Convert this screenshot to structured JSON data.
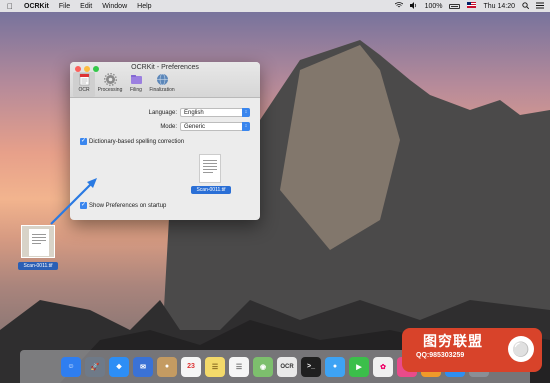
{
  "menubar": {
    "app_name": "OCRKit",
    "items": [
      "File",
      "Edit",
      "Window",
      "Help"
    ],
    "battery": "100%",
    "clock": "Thu 14:20"
  },
  "window": {
    "title": "OCRKit - Preferences",
    "toolbar": [
      {
        "label": "OCR",
        "icon": "ocr-icon"
      },
      {
        "label": "Processing",
        "icon": "gear-icon"
      },
      {
        "label": "Filing",
        "icon": "folder-icon"
      },
      {
        "label": "Finalization",
        "icon": "globe-icon"
      }
    ],
    "language_label": "Language:",
    "language_value": "English",
    "mode_label": "Mode:",
    "mode_value": "Generic",
    "spelling_label": "Dictionary-based spelling correction",
    "startup_label": "Show Preferences on startup",
    "thumb_label": "Scan-0011.tif"
  },
  "desktop": {
    "file_label": "Scan-0011.tif"
  },
  "dock": {
    "items": [
      {
        "name": "finder",
        "color": "#2f7ef0"
      },
      {
        "name": "launchpad",
        "color": "#6f7a88"
      },
      {
        "name": "safari",
        "color": "#2d8ef5"
      },
      {
        "name": "mail",
        "color": "#3a72d6"
      },
      {
        "name": "contacts",
        "color": "#c49b62"
      },
      {
        "name": "calendar",
        "color": "#f5f5f5"
      },
      {
        "name": "notes",
        "color": "#f3d96a"
      },
      {
        "name": "reminders",
        "color": "#f5f5f5"
      },
      {
        "name": "maps",
        "color": "#7dbf6d"
      },
      {
        "name": "ocrkit",
        "color": "#e9e9e9"
      },
      {
        "name": "terminal",
        "color": "#1f1f1f"
      },
      {
        "name": "messages",
        "color": "#3ea3f4"
      },
      {
        "name": "facetime",
        "color": "#3bbf4a"
      },
      {
        "name": "photos",
        "color": "#f0f0f0"
      },
      {
        "name": "itunes",
        "color": "#e94b8a"
      },
      {
        "name": "ibooks",
        "color": "#f09a2a"
      },
      {
        "name": "app-store",
        "color": "#2f8ff0"
      },
      {
        "name": "system-preferences",
        "color": "#8a8f96"
      }
    ]
  },
  "watermark": {
    "title": "图穷联盟",
    "sub": "QQ:985303259"
  }
}
